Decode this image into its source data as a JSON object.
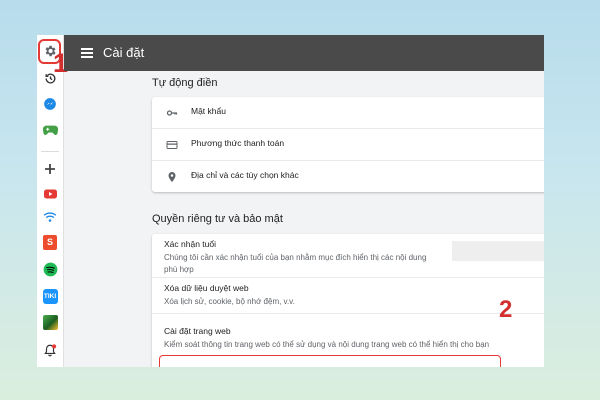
{
  "header": {
    "title": "Cài đặt"
  },
  "sidebar": {
    "items": [
      {
        "icon": "gear-icon"
      },
      {
        "icon": "history-icon"
      },
      {
        "icon": "messenger-icon"
      },
      {
        "icon": "gamepad-icon"
      },
      {
        "icon": "add-icon"
      },
      {
        "icon": "youtube-icon"
      },
      {
        "icon": "wifi-icon"
      },
      {
        "icon": "shopee-icon"
      },
      {
        "icon": "spotify-icon"
      },
      {
        "icon": "tiki-icon"
      },
      {
        "icon": "game-icon"
      },
      {
        "icon": "bell-icon"
      }
    ]
  },
  "markers": {
    "one": "1",
    "two": "2"
  },
  "autofill": {
    "title": "Tự động điền",
    "items": [
      {
        "icon": "key-icon",
        "label": "Mật khẩu"
      },
      {
        "icon": "credit-card-icon",
        "label": "Phương thức thanh toán"
      },
      {
        "icon": "location-pin-icon",
        "label": "Địa chỉ và các tùy chọn khác"
      }
    ]
  },
  "privacy": {
    "title": "Quyền riêng tư và bảo mật",
    "items": [
      {
        "title": "Xác nhận tuổi",
        "desc": "Chúng tôi cần xác nhận tuổi của bạn nhằm mục đích hiển thị các nội dung phù hợp"
      },
      {
        "title": "Xóa dữ liệu duyệt web",
        "desc": "Xóa lịch sử, cookie, bộ nhớ đệm, v.v."
      },
      {
        "title": "Cài đặt trang web",
        "desc": "Kiểm soát thông tin trang web có thể sử dụng và nội dung trang web có thể hiển thị cho bạn"
      }
    ]
  },
  "colors": {
    "accent_red": "#e53935",
    "topbar": "#4a4a4a",
    "content_bg": "#f1f3f4"
  }
}
